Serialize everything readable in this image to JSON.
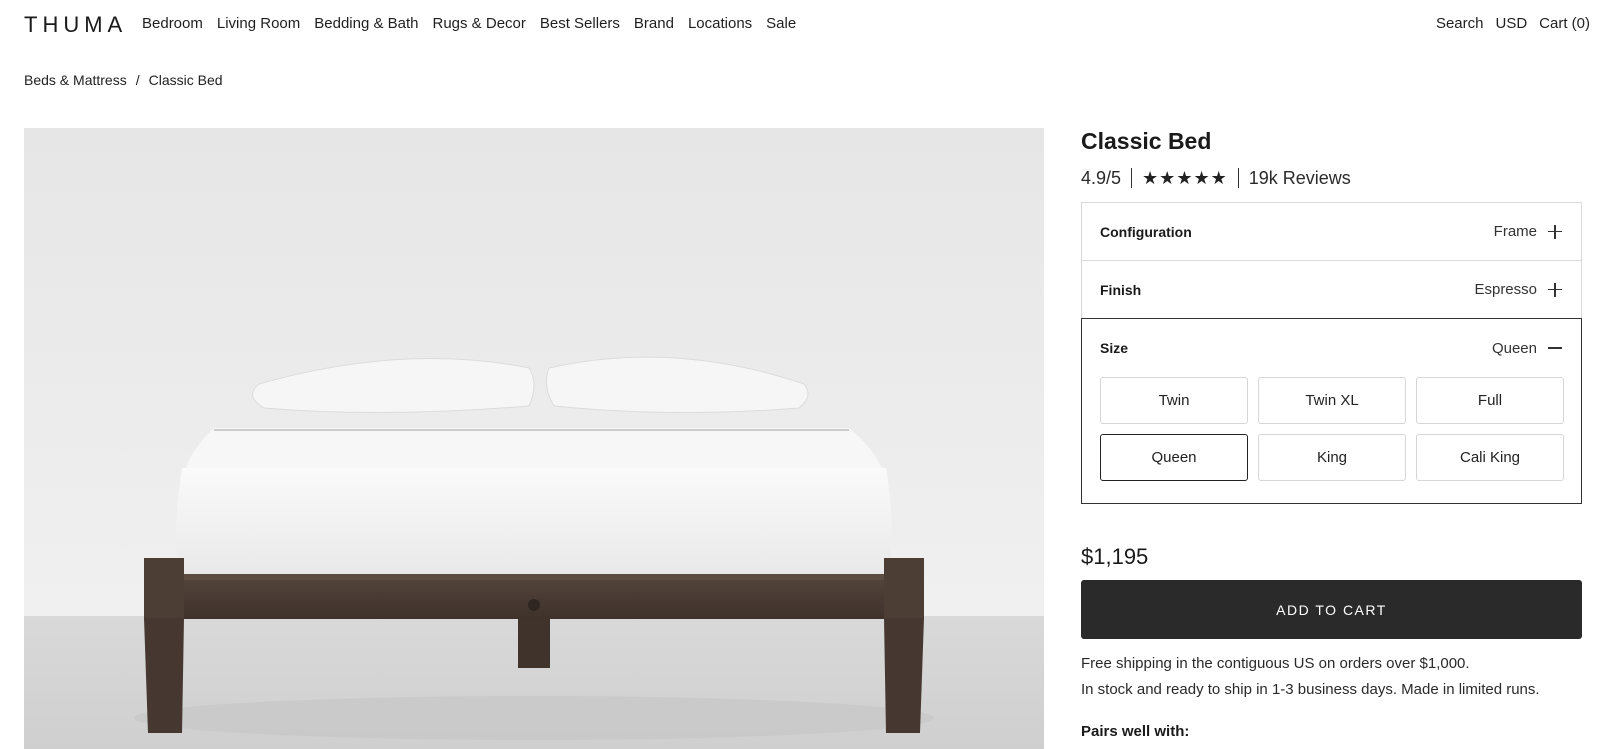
{
  "header": {
    "logo": "THUMA",
    "nav": [
      "Bedroom",
      "Living Room",
      "Bedding & Bath",
      "Rugs & Decor",
      "Best Sellers",
      "Brand",
      "Locations",
      "Sale"
    ],
    "search": "Search",
    "currency": "USD",
    "cart": "Cart (0)"
  },
  "breadcrumb": {
    "parent": "Beds & Mattress",
    "separator": "/",
    "current": "Classic Bed"
  },
  "product": {
    "title": "Classic Bed",
    "rating": "4.9/5",
    "stars": "★★★★★",
    "stars_value": 5,
    "reviews": "19k Reviews",
    "options": {
      "configuration": {
        "label": "Configuration",
        "value": "Frame"
      },
      "finish": {
        "label": "Finish",
        "value": "Espresso"
      },
      "size": {
        "label": "Size",
        "value": "Queen",
        "choices": [
          "Twin",
          "Twin XL",
          "Full",
          "Queen",
          "King",
          "Cali King"
        ],
        "selected": "Queen"
      }
    },
    "price": "$1,195",
    "add_to_cart": "ADD TO CART",
    "shipping_line1": "Free shipping in the contiguous US on orders over $1,000.",
    "shipping_line2": "In stock and ready to ship in 1-3 business days. Made in limited runs.",
    "pairs_well": "Pairs well with:"
  },
  "colors": {
    "button_bg": "#2a2a2a",
    "frame_wood": "#4a3b33",
    "image_bg": "#ececec"
  }
}
